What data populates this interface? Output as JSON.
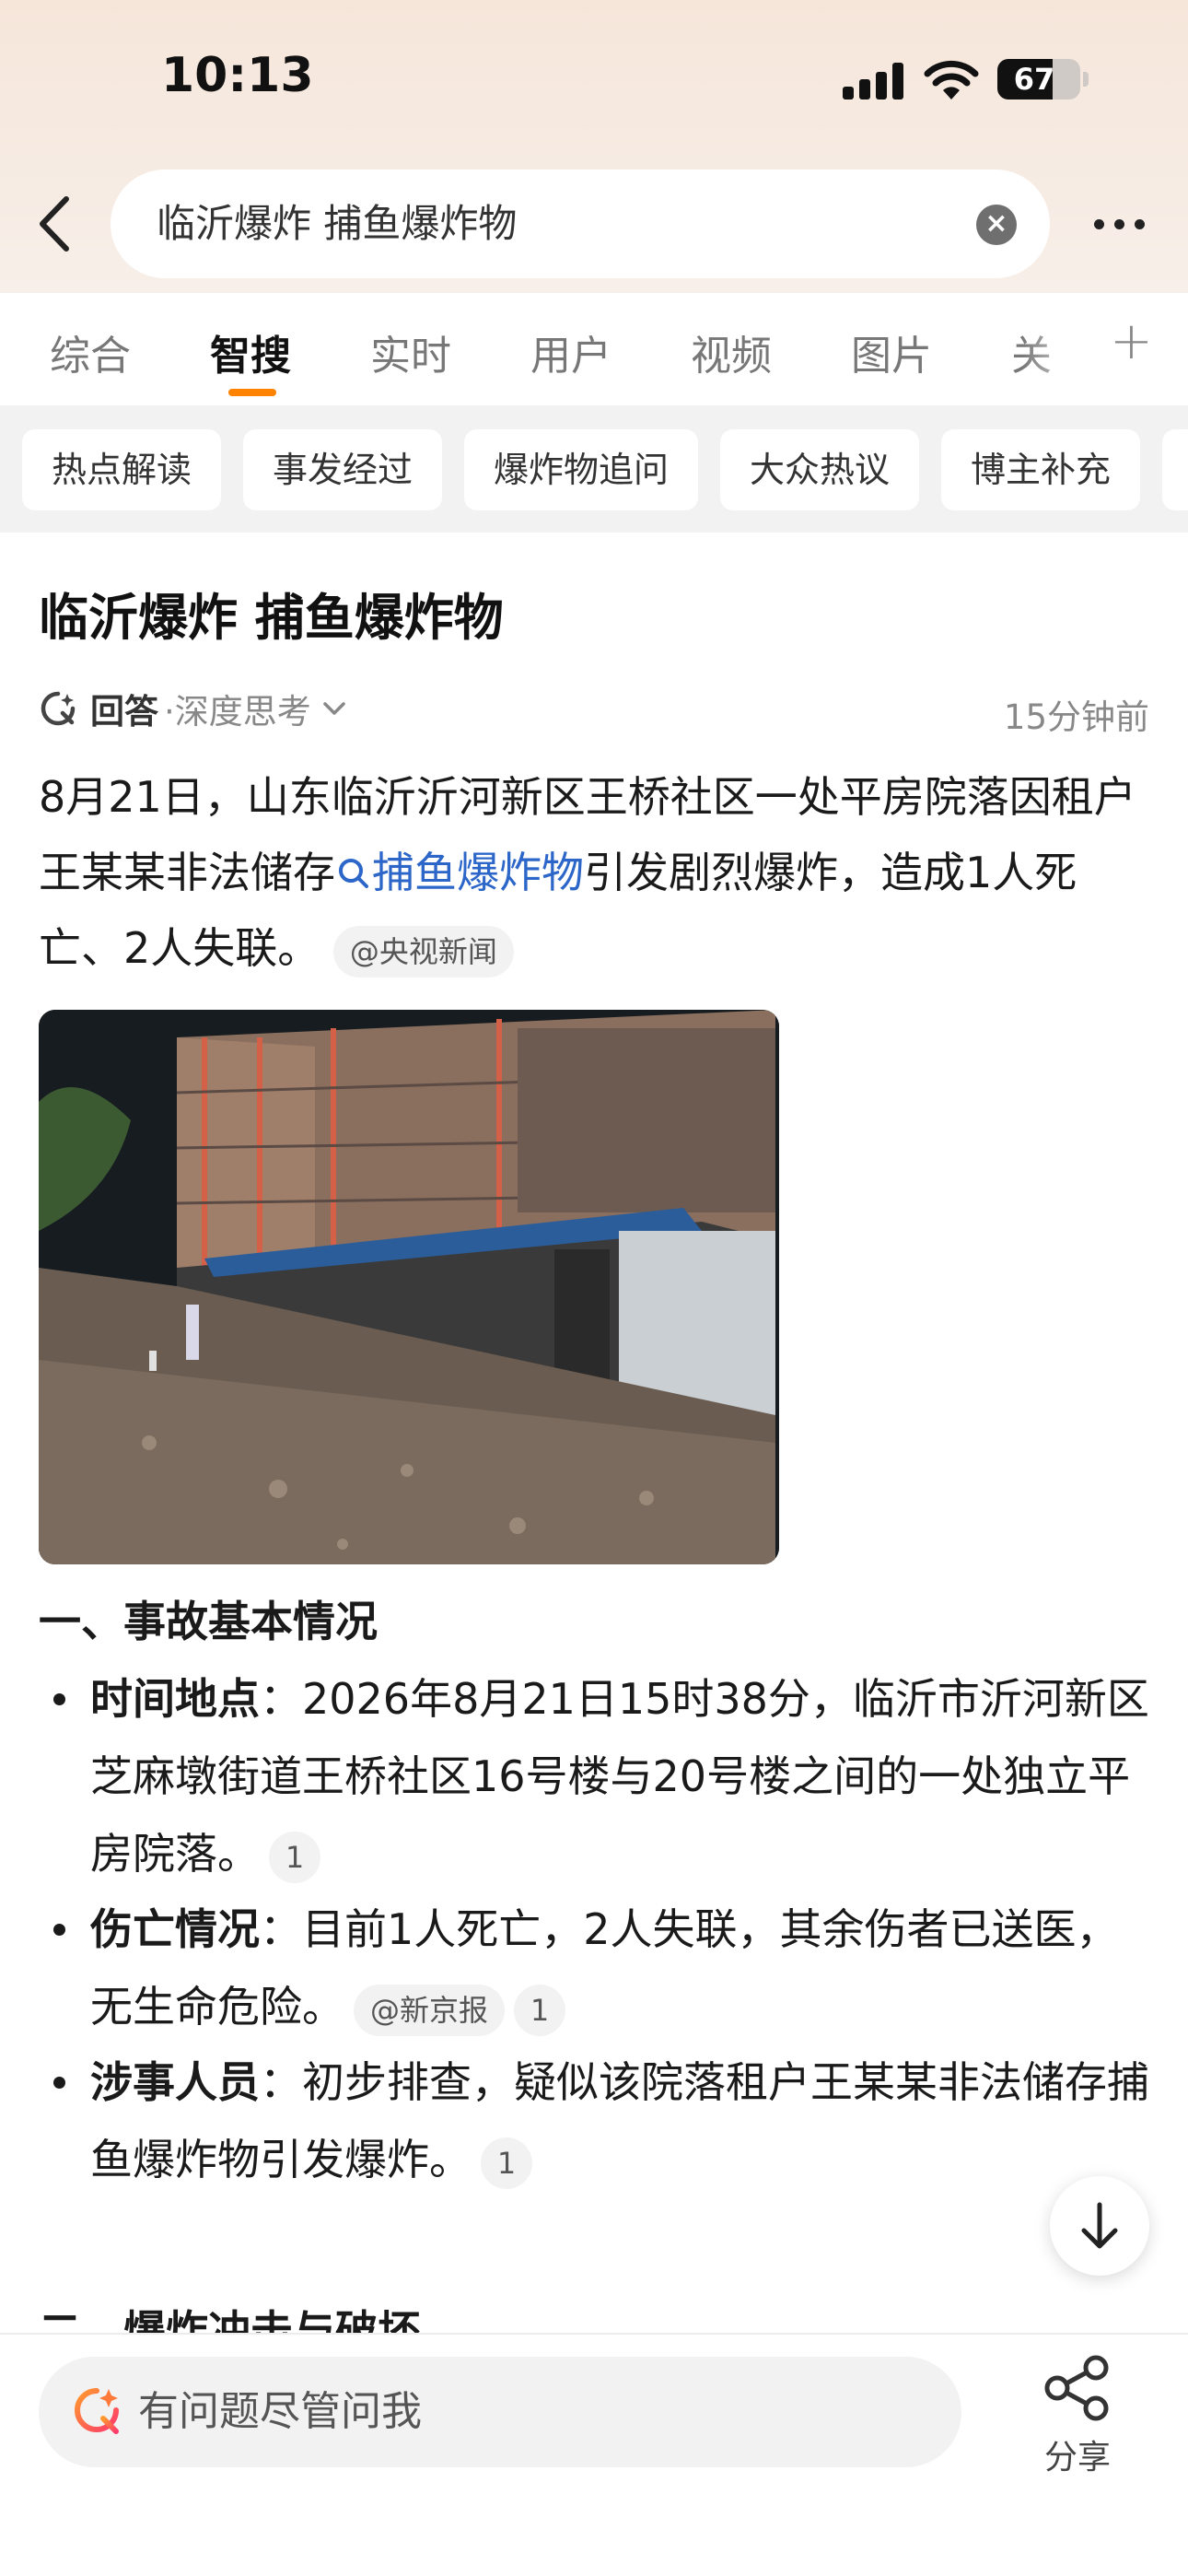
{
  "status": {
    "time": "10:13",
    "battery": "67",
    "battery_level": 0.67
  },
  "search": {
    "query": "临沂爆炸 捕鱼爆炸物"
  },
  "tabs": [
    {
      "label": "综合"
    },
    {
      "label": "智搜",
      "active": true
    },
    {
      "label": "实时"
    },
    {
      "label": "用户"
    },
    {
      "label": "视频"
    },
    {
      "label": "图片"
    },
    {
      "label": "关"
    }
  ],
  "chips": [
    "热点解读",
    "事发经过",
    "爆炸物追问",
    "大众热议",
    "博主补充"
  ],
  "article": {
    "title": "临沂爆炸 捕鱼爆炸物",
    "answer_label": "回答",
    "answer_mode": "·深度思考",
    "time_ago": "15分钟前",
    "intro_before": "8月21日，山东临沂沂河新区王桥社区一处平房院落因租户王某某非法储存",
    "intro_link": "捕鱼爆炸物",
    "intro_after": "引发剧烈爆炸，造成1人死亡、2人失联。",
    "intro_source": "@央视新闻",
    "section1_title": "一、事故基本情况",
    "bullets": [
      {
        "label": "时间地点",
        "text": "：2026年8月21日15时38分，临沂市沂河新区芝麻墩街道王桥社区16号楼与20号楼之间的一处独立平房院落。",
        "source": "",
        "cite": "1"
      },
      {
        "label": "伤亡情况",
        "text": "：目前1人死亡，2人失联，其余伤者已送医，无生命危险。",
        "source": "@新京报",
        "cite": "1"
      },
      {
        "label": "涉事人员",
        "text": "：初步排查，疑似该院落租户王某某非法储存捕鱼爆炸物引发爆炸。",
        "source": "",
        "cite": "1"
      }
    ],
    "section2_title": "二、爆炸冲击与破坏"
  },
  "bottom": {
    "ask_placeholder": "有问题尽管问我",
    "share_label": "分享"
  },
  "colors": {
    "accent": "#ff8200",
    "link": "#2c66c8"
  }
}
